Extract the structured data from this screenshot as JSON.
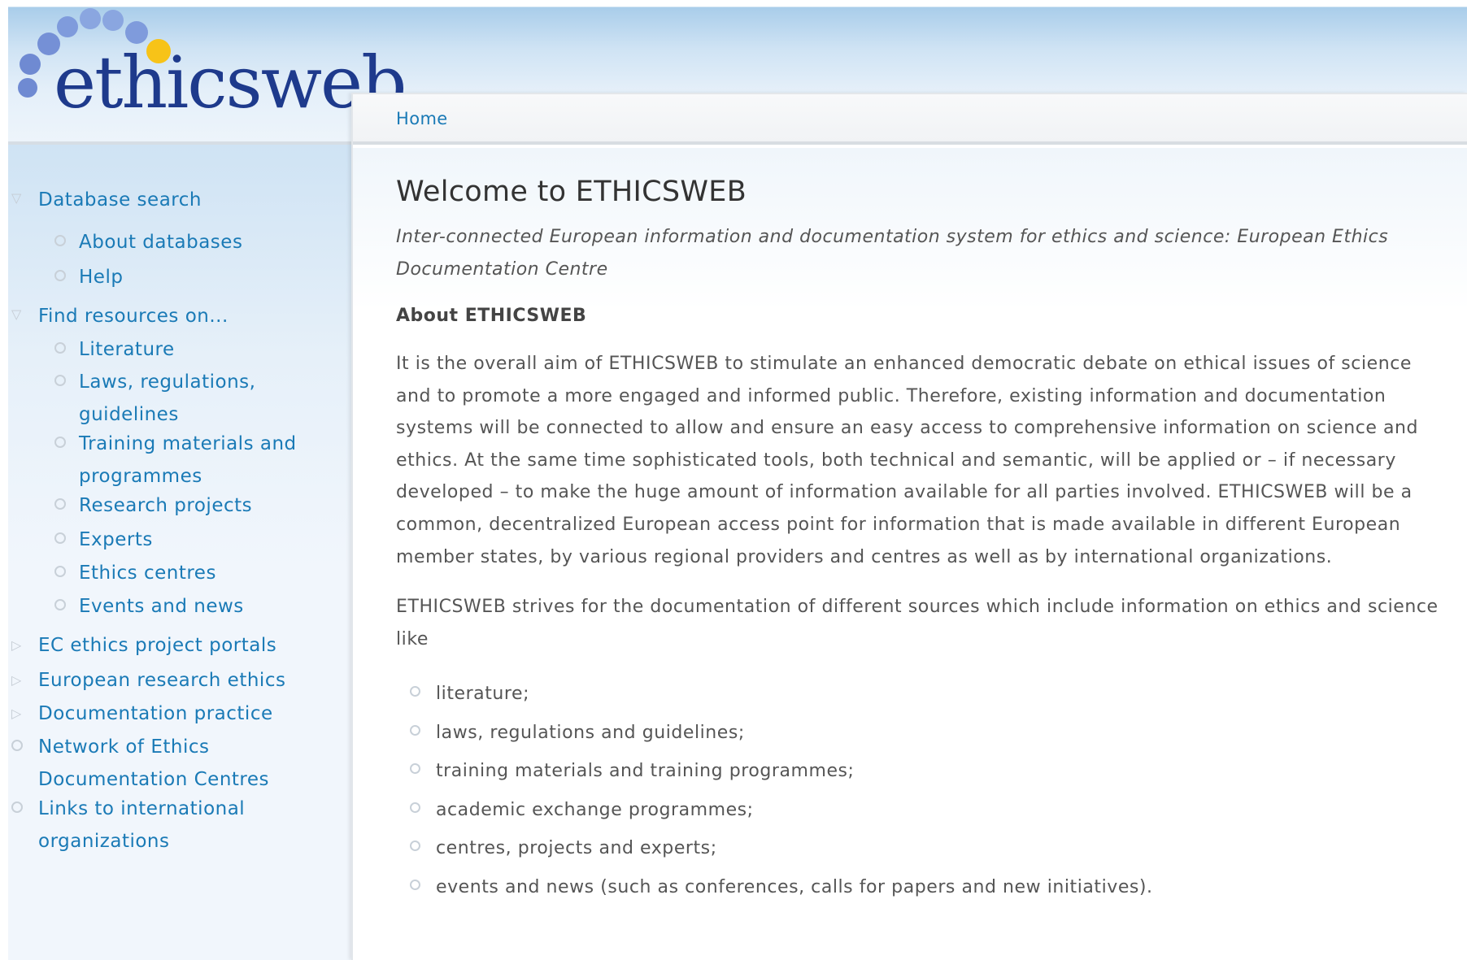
{
  "logo": {
    "text": "ethicsweb",
    "colors": {
      "text": "#1e3a8c",
      "dots": "#6f8fd8",
      "accent_dot": "#f7c318"
    }
  },
  "breadcrumb": {
    "home_label": "Home"
  },
  "sidebar": {
    "items": [
      {
        "label": "Database search",
        "type": "expanded"
      },
      {
        "label": "About databases",
        "type": "sub"
      },
      {
        "label": "Help",
        "type": "sub"
      },
      {
        "label": "Find resources on...",
        "type": "expanded"
      },
      {
        "label": "Literature",
        "type": "sub"
      },
      {
        "label": "Laws, regulations, guidelines",
        "type": "sub"
      },
      {
        "label": "Training materials and programmes",
        "type": "sub"
      },
      {
        "label": "Research projects",
        "type": "sub"
      },
      {
        "label": "Experts",
        "type": "sub"
      },
      {
        "label": "Ethics centres",
        "type": "sub"
      },
      {
        "label": "Events and news",
        "type": "sub"
      },
      {
        "label": "EC ethics project portals",
        "type": "collapsed"
      },
      {
        "label": "European research ethics",
        "type": "collapsed"
      },
      {
        "label": "Documentation practice",
        "type": "collapsed"
      },
      {
        "label": "Network of Ethics Documentation Centres",
        "type": "leaf"
      },
      {
        "label": "Links to international organizations",
        "type": "leaf"
      }
    ]
  },
  "main": {
    "title": "Welcome to ETHICSWEB",
    "subtitle": "Inter-connected European information and documentation system for ethics and science: European Ethics Documentation Centre",
    "section_heading": "About ETHICSWEB",
    "paragraph1": "It is the overall aim of ETHICSWEB to stimulate an enhanced democratic debate on ethical issues of science and to promote a more engaged and informed public. Therefore, existing information and documentation systems will be connected to allow and ensure an easy access to comprehensive information on science and ethics. At the same time sophisticated tools, both technical and semantic, will be applied or – if necessary developed – to make the huge amount of information available for all parties involved. ETHICSWEB will be a common, decentralized European access point for information that is made available in different European member states, by various regional providers and centres as well as by international organizations.",
    "paragraph2": "ETHICSWEB strives for the documentation of different sources which include information on ethics and science like",
    "bullets": [
      "literature;",
      "laws, regulations and guidelines;",
      "training materials and training programmes;",
      "academic exchange programmes;",
      "centres, projects and experts;",
      "events and news (such as conferences, calls for papers and new initiatives)."
    ]
  },
  "colors": {
    "link": "#1a7ab6",
    "body_text": "#555555",
    "heading": "#333333"
  }
}
